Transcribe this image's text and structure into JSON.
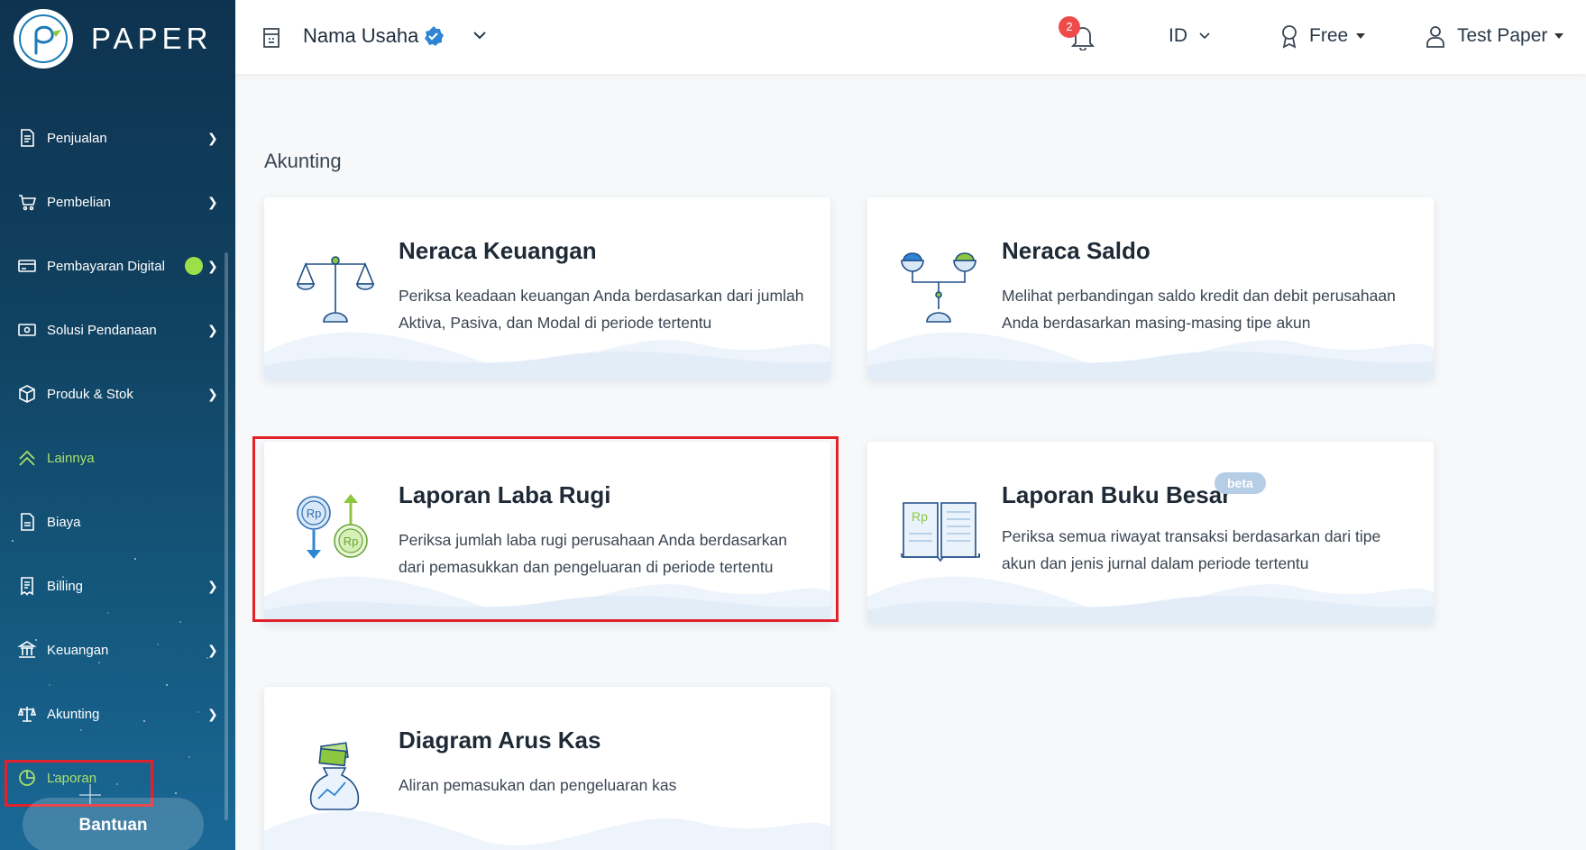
{
  "app": {
    "logo_text": "PAPER"
  },
  "header": {
    "business_name": "Nama Usaha",
    "notification_count": "2",
    "language": "ID",
    "plan": "Free",
    "user_name": "Test Paper"
  },
  "sidebar": {
    "items": [
      {
        "label": "Penjualan",
        "icon": "receipt-icon",
        "has_chevron": true
      },
      {
        "label": "Pembelian",
        "icon": "cart-icon",
        "has_chevron": true
      },
      {
        "label": "Pembayaran Digital",
        "icon": "card-icon",
        "has_chevron": true,
        "has_dot": true
      },
      {
        "label": "Solusi Pendanaan",
        "icon": "cash-icon",
        "has_chevron": true
      },
      {
        "label": "Produk & Stok",
        "icon": "box-icon",
        "has_chevron": true
      },
      {
        "label": "Lainnya",
        "icon": "double-chevron-up-icon",
        "has_chevron": false,
        "active": true
      },
      {
        "label": "Biaya",
        "icon": "document-icon",
        "has_chevron": false
      },
      {
        "label": "Billing",
        "icon": "bill-icon",
        "has_chevron": true
      },
      {
        "label": "Keuangan",
        "icon": "bank-icon",
        "has_chevron": true
      },
      {
        "label": "Akunting",
        "icon": "scale-icon",
        "has_chevron": true
      },
      {
        "label": "Laporan",
        "icon": "pie-chart-icon",
        "has_chevron": false,
        "active": true
      }
    ],
    "help_button": "Bantuan"
  },
  "main": {
    "section_title": "Akunting",
    "cards": [
      {
        "title": "Neraca Keuangan",
        "description": "Periksa keadaan keuangan Anda berdasarkan dari jumlah Aktiva, Pasiva, dan Modal di periode tertentu",
        "icon": "balance-scale-icon"
      },
      {
        "title": "Neraca Saldo",
        "description": "Melihat perbandingan saldo kredit dan debit perusahaan Anda berdasarkan masing-masing tipe akun",
        "icon": "trial-balance-icon"
      },
      {
        "title": "Laporan Laba Rugi",
        "description": "Periksa jumlah laba rugi perusahaan Anda berdasarkan dari pemasukkan dan pengeluaran di periode tertentu",
        "icon": "profit-loss-icon"
      },
      {
        "title": "Laporan Buku Besar",
        "description": "Periksa semua riwayat transaksi berdasarkan dari tipe akun dan jenis jurnal dalam periode tertentu",
        "icon": "ledger-book-icon",
        "badge": "beta"
      },
      {
        "title": "Diagram Arus Kas",
        "description": "Aliran pemasukan dan pengeluaran kas",
        "icon": "money-bag-icon"
      }
    ]
  },
  "colors": {
    "sidebar_top": "#0e3350",
    "sidebar_bottom": "#1a6896",
    "accent_green": "#a7e06a",
    "highlight_red": "#e2222a",
    "icon_blue": "#2f6fb5"
  },
  "rp_label": "Rp"
}
